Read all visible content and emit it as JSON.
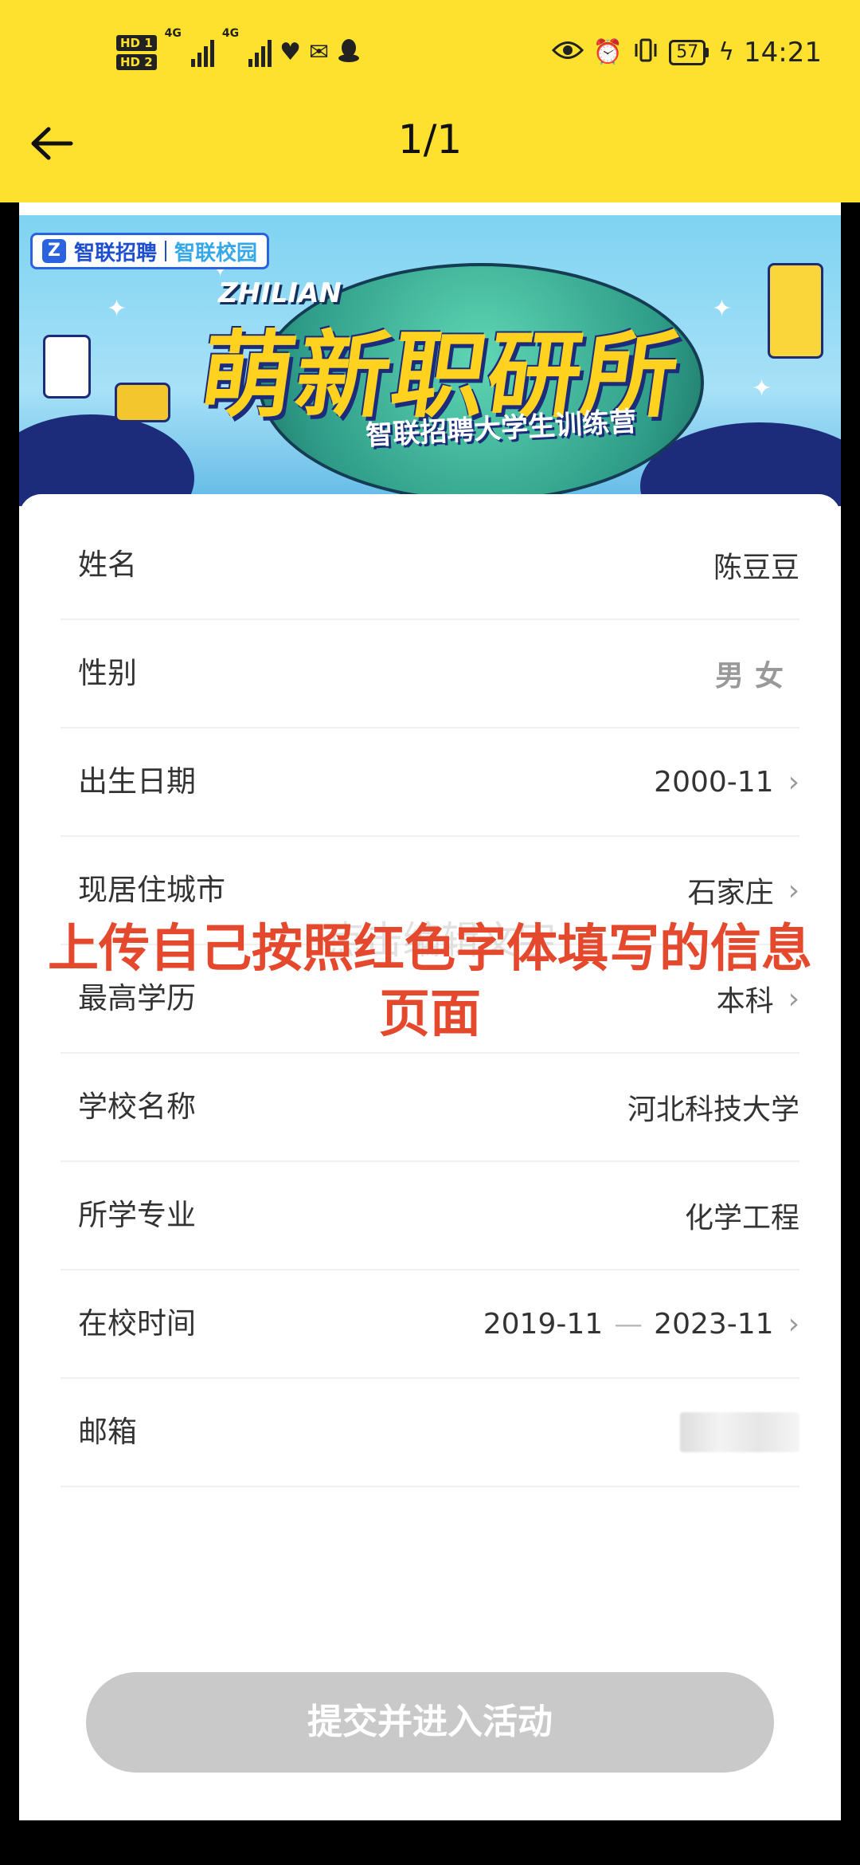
{
  "status_bar": {
    "hd1": "HD 1",
    "hd2": "HD 2",
    "net1": "4G",
    "net2": "4G",
    "battery": "57",
    "time": "14:21"
  },
  "header": {
    "title": "1/1"
  },
  "banner": {
    "brand1": "智联招聘",
    "brand2": "智联校园",
    "tag": "ZHILIAN",
    "title": "萌新职研所",
    "subtitle": "智联招聘大学生训练营"
  },
  "form": {
    "rows": [
      {
        "label": "姓名",
        "value": "陈豆豆"
      },
      {
        "label": "性别",
        "options": [
          "男",
          "女"
        ]
      },
      {
        "label": "出生日期",
        "value": "2000-11"
      },
      {
        "label": "现居住城市",
        "value": "石家庄"
      },
      {
        "label": "最高学历",
        "value": "本科"
      },
      {
        "label": "学校名称",
        "value": "河北科技大学"
      },
      {
        "label": "所学专业",
        "value": "化学工程"
      },
      {
        "label": "在校时间",
        "start": "2019-11",
        "separator": "—",
        "end": "2023-11"
      },
      {
        "label": "邮箱",
        "value": ""
      }
    ]
  },
  "overlay": {
    "line1": "上传自己按照红色字体填写的信息",
    "line2": "页面",
    "ghost": "点击编辑文字"
  },
  "submit_label": "提交并进入活动",
  "colors": {
    "header_bg": "#fde12e",
    "overlay_text": "#e4492d",
    "submit_disabled": "#c9c9c9"
  }
}
